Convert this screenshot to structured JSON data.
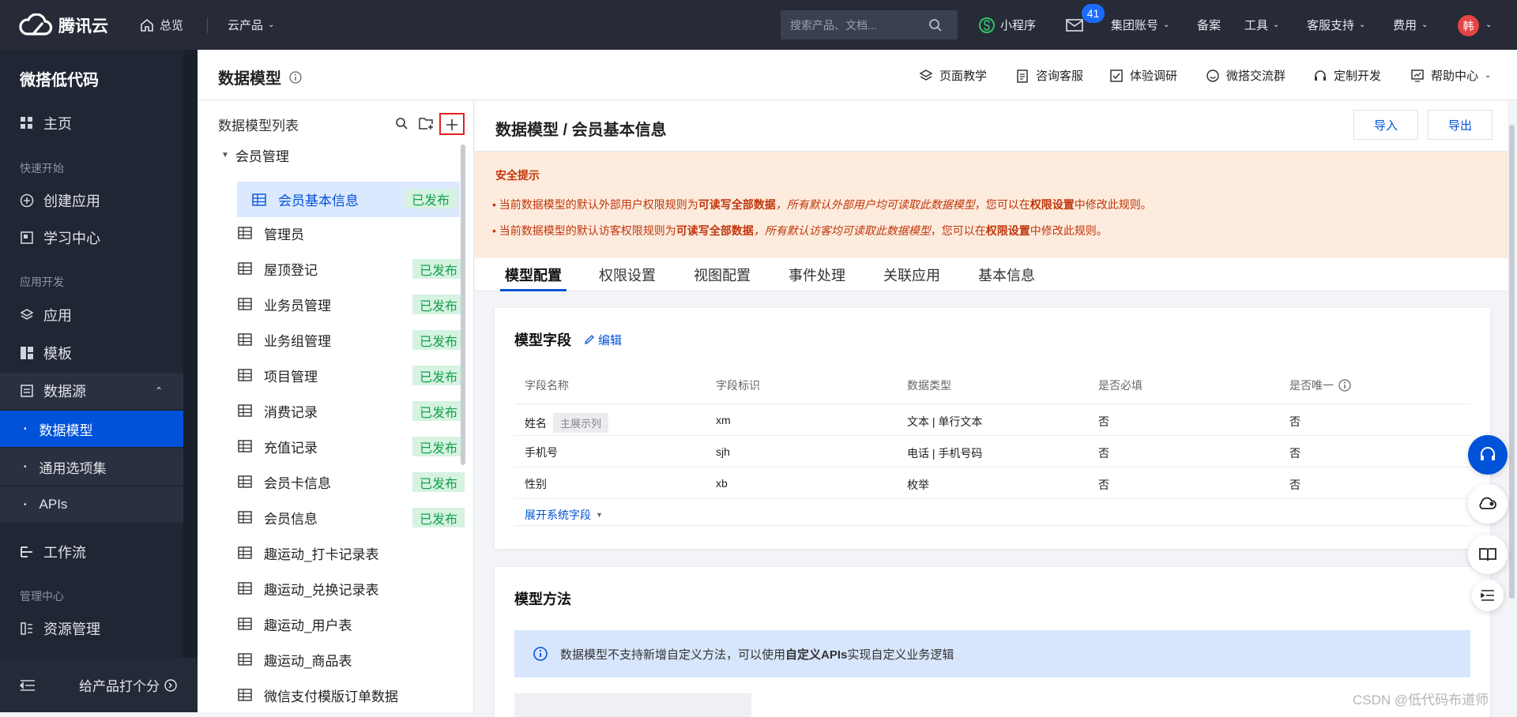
{
  "topbar": {
    "brand": "腾讯云",
    "home": "总览",
    "products": "云产品",
    "search_placeholder": "搜索产品、文档...",
    "mini_program": "小程序",
    "message_count": "41",
    "group_account": "集团账号",
    "filing": "备案",
    "tools": "工具",
    "support": "客服支持",
    "fees": "费用",
    "avatar": "韩"
  },
  "sidebar": {
    "app_title": "微搭低代码",
    "home": "主页",
    "section_quick": "快速开始",
    "create_app": "创建应用",
    "learning": "学习中心",
    "section_dev": "应用开发",
    "apps": "应用",
    "templates": "模板",
    "datasource": "数据源",
    "data_model": "数据模型",
    "option_sets": "通用选项集",
    "apis": "APIs",
    "workflow": "工作流",
    "section_mgmt": "管理中心",
    "resources": "资源管理",
    "rate": "给产品打个分"
  },
  "page_header": {
    "title": "数据模型",
    "links": [
      "页面教学",
      "咨询客服",
      "体验调研",
      "微搭交流群",
      "定制开发",
      "帮助中心"
    ]
  },
  "model_list": {
    "header": "数据模型列表",
    "group": "会员管理",
    "items": [
      {
        "name": "会员基本信息",
        "tag": "已发布"
      },
      {
        "name": "管理员",
        "tag": ""
      },
      {
        "name": "屋顶登记",
        "tag": "已发布"
      },
      {
        "name": "业务员管理",
        "tag": "已发布"
      },
      {
        "name": "业务组管理",
        "tag": "已发布"
      },
      {
        "name": "项目管理",
        "tag": "已发布"
      },
      {
        "name": "消费记录",
        "tag": "已发布"
      },
      {
        "name": "充值记录",
        "tag": "已发布"
      },
      {
        "name": "会员卡信息",
        "tag": "已发布"
      },
      {
        "name": "会员信息",
        "tag": "已发布"
      },
      {
        "name": "趣运动_打卡记录表",
        "tag": ""
      },
      {
        "name": "趣运动_兑换记录表",
        "tag": ""
      },
      {
        "name": "趣运动_用户表",
        "tag": ""
      },
      {
        "name": "趣运动_商品表",
        "tag": ""
      },
      {
        "name": "微信支付模版订单数据",
        "tag": ""
      }
    ]
  },
  "detail": {
    "breadcrumb": "数据模型 / 会员基本信息",
    "import": "导入",
    "export": "导出",
    "warning": {
      "title": "安全提示",
      "line1_a": "当前数据模型的默认外部用户权限规则为",
      "line1_b": "可读写全部数据",
      "line1_c": "，所有默认外部用户均可读取此数据模型",
      "line1_d": "，您可以在",
      "line1_e": "权限设置",
      "line1_f": "中修改此规则。",
      "line2_a": "当前数据模型的默认访客权限规则为",
      "line2_b": "可读写全部数据",
      "line2_c": "，所有默认访客均可读取此数据模型",
      "line2_d": "，您可以在",
      "line2_e": "权限设置",
      "line2_f": "中修改此规则。"
    },
    "tabs": [
      "模型配置",
      "权限设置",
      "视图配置",
      "事件处理",
      "关联应用",
      "基本信息"
    ],
    "fields_card": {
      "title": "模型字段",
      "edit": "编辑",
      "columns": [
        "字段名称",
        "字段标识",
        "数据类型",
        "是否必填",
        "是否唯一"
      ],
      "rows": [
        {
          "name": "姓名",
          "tag": "主展示列",
          "id": "xm",
          "type": "文本 | 单行文本",
          "required": "否",
          "unique": "否"
        },
        {
          "name": "手机号",
          "tag": "",
          "id": "sjh",
          "type": "电话 | 手机号码",
          "required": "否",
          "unique": "否"
        },
        {
          "name": "性别",
          "tag": "",
          "id": "xb",
          "type": "枚举",
          "required": "否",
          "unique": "否"
        }
      ],
      "expand": "展开系统字段"
    },
    "methods_card": {
      "title": "模型方法",
      "info_a": "数据模型不支持新增自定义方法，可以使用",
      "info_b": "自定义APIs",
      "info_c": "实现自定义业务逻辑"
    }
  },
  "watermark": "CSDN @低代码布道师",
  "colors": {
    "primary": "#0052d9",
    "topbar": "#262b37",
    "sidebar": "#202634",
    "published_bg": "#d5f3e0",
    "published_text": "#14a04e",
    "warn_bg": "#fdebdd",
    "highlight_box": "#e02020"
  }
}
